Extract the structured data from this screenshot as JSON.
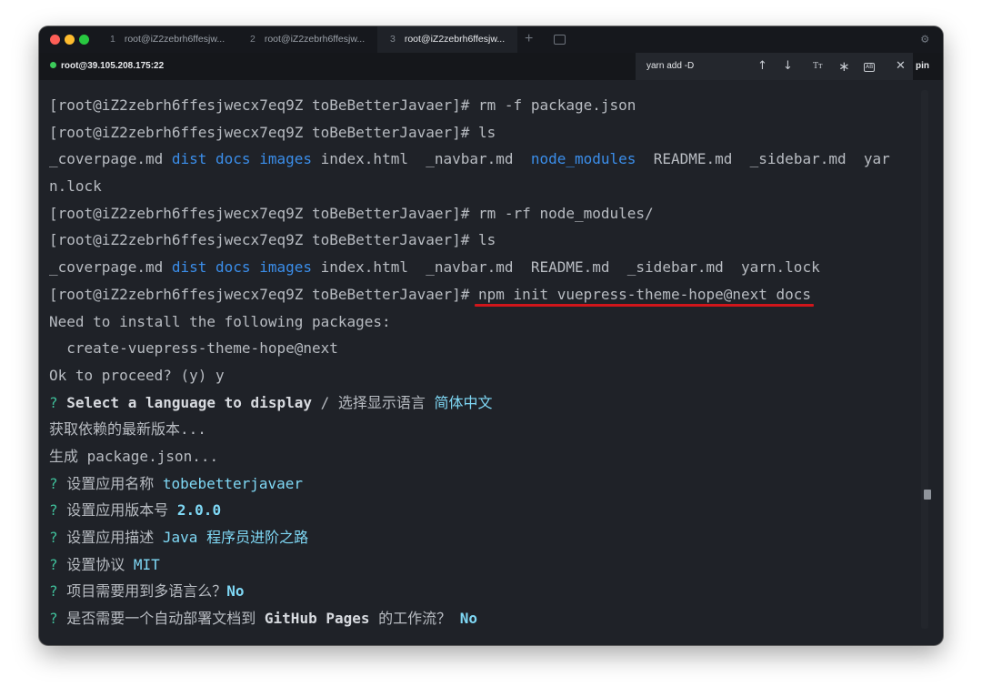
{
  "tabs": [
    {
      "number": "1",
      "title": "root@iZ2zebrh6ffesjw..."
    },
    {
      "number": "2",
      "title": "root@iZ2zebrh6ffesjw..."
    },
    {
      "number": "3",
      "title": "root@iZ2zebrh6ffesjw..."
    }
  ],
  "new_tab_label": "+",
  "session": {
    "label": "root@39.105.208.175:22",
    "status_color": "#3ccb5a"
  },
  "find": {
    "query": "yarn add -D",
    "case_label": "Tт",
    "word_label": "AB"
  },
  "pin_label": "pin",
  "terminal": {
    "prompt": "[root@iZ2zebrh6ffesjwecx7eq9Z toBeBetterJavaer]# ",
    "lines": {
      "l1": "rm -f package.json",
      "l2": "ls",
      "l3": {
        "a": "_coverpage.md ",
        "b": "dist",
        "c": " ",
        "d": "docs",
        "e": " ",
        "f": "images",
        "g": " index.html  _navbar.md  ",
        "h": "node_modules",
        "i": "  README.md  _sidebar.md  yar"
      },
      "l4": "n.lock",
      "l5": "rm -rf node_modules/",
      "l6": "ls",
      "l7": {
        "a": "_coverpage.md ",
        "b": "dist",
        "c": " ",
        "d": "docs",
        "e": " ",
        "f": "images",
        "g": " index.html  _navbar.md  README.md  _sidebar.md  yarn.lock"
      },
      "l8": "npm init vuepress-theme-hope@next docs",
      "l9": "Need to install the following packages:",
      "l10": "  create-vuepress-theme-hope@next",
      "l11": "Ok to proceed? (y) y",
      "l12": {
        "q": "? ",
        "bold": "Select a language to display",
        "rest": " / 选择显示语言 ",
        "answer": "简体中文"
      },
      "l13": "获取依赖的最新版本...",
      "l14": "生成 package.json...",
      "l15": {
        "q": "? ",
        "text": "设置应用名称 ",
        "answer": "tobebetterjavaer"
      },
      "l16": {
        "q": "? ",
        "text": "设置应用版本号 ",
        "answer": "2.0.0"
      },
      "l17": {
        "q": "? ",
        "text": "设置应用描述 ",
        "answer_a": "Java",
        "answer_b": " 程序员进阶之路"
      },
      "l18": {
        "q": "? ",
        "text": "设置协议 ",
        "answer": "MIT"
      },
      "l19": {
        "q": "? ",
        "text": "项目需要用到多语言么？",
        "answer": "No"
      },
      "l20": {
        "q": "? ",
        "text_a": "是否需要一个自动部署文档到 ",
        "bold": "GitHub Pages",
        "text_b": " 的工作流？ ",
        "answer": "No"
      }
    }
  },
  "colors": {
    "directory": "#3b8eea",
    "prompt_mark": "#3fbf9a",
    "answer": "#7fd8f5",
    "highlight_underline": "#d0161b"
  }
}
